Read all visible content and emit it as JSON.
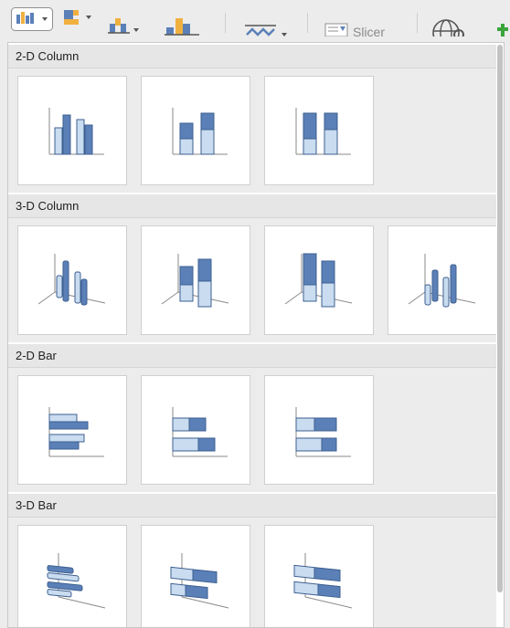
{
  "toolbar": {
    "buttons": [
      {
        "name": "column-chart",
        "icon": "column-chart-icon"
      },
      {
        "name": "hierarchy-chart",
        "icon": "hierarchy-chart-icon"
      },
      {
        "name": "waterfall-chart",
        "icon": "waterfall-chart-icon"
      },
      {
        "name": "combo-chart",
        "icon": "combo-chart-icon"
      },
      {
        "name": "sparkline",
        "icon": "sparkline-icon"
      },
      {
        "name": "slicer",
        "icon": "slicer-icon"
      },
      {
        "name": "map",
        "icon": "globe-icon"
      },
      {
        "name": "add",
        "icon": "plus-icon"
      }
    ],
    "slicer_label": "Slicer"
  },
  "sections": [
    {
      "title": "2-D Column",
      "items": [
        "Clustered Column",
        "Stacked Column",
        "100% Stacked Column"
      ]
    },
    {
      "title": "3-D Column",
      "items": [
        "3-D Clustered Column",
        "3-D Stacked Column",
        "3-D 100% Stacked Column",
        "3-D Column"
      ]
    },
    {
      "title": "2-D Bar",
      "items": [
        "Clustered Bar",
        "Stacked Bar",
        "100% Stacked Bar"
      ]
    },
    {
      "title": "3-D Bar",
      "items": [
        "3-D Clustered Bar",
        "3-D Stacked Bar",
        "3-D 100% Stacked Bar"
      ]
    }
  ],
  "colors": {
    "dark_blue": "#5b80b8",
    "light_blue": "#c9dcf0",
    "outline": "#3d5f90",
    "axis": "#8a8a8a"
  }
}
